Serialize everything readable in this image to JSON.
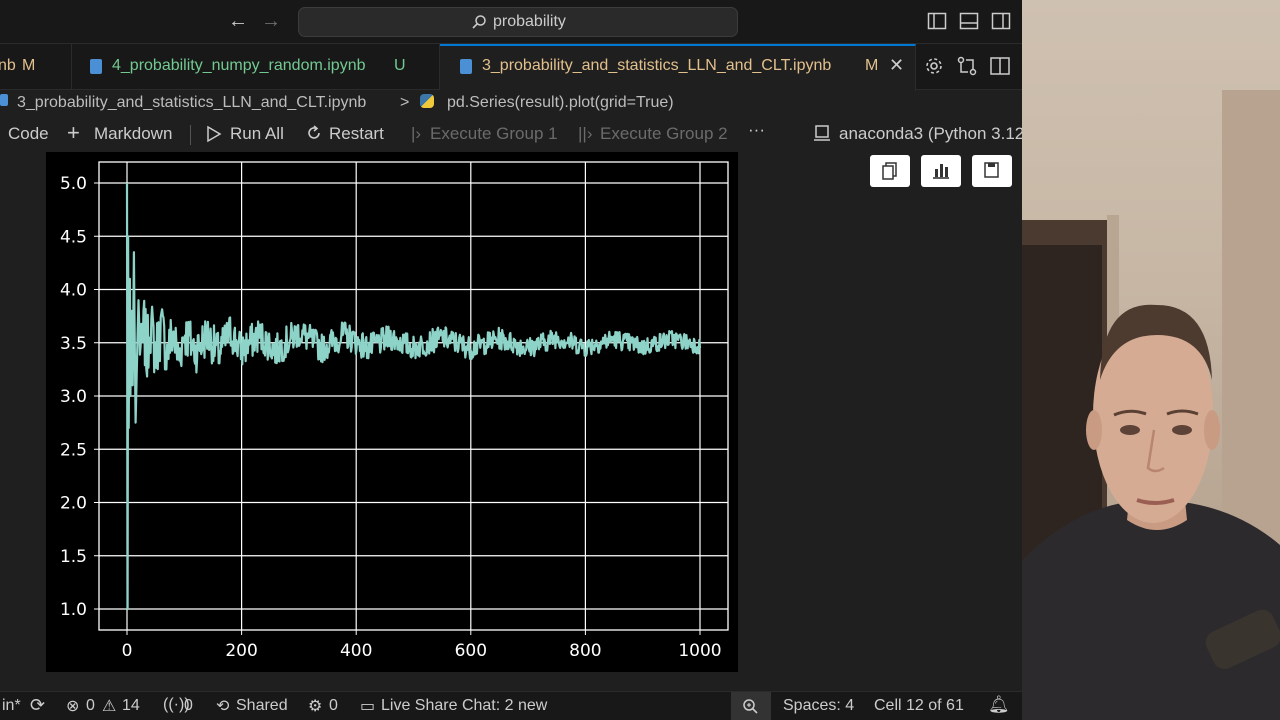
{
  "titlebar": {
    "search_text": "probability"
  },
  "tabs": [
    {
      "name": "nb",
      "status": "M",
      "name_color": "#e2c08d",
      "status_color": "#e2c08d"
    },
    {
      "name": "4_probability_numpy_random.ipynb",
      "status": "U",
      "name_color": "#73c991",
      "status_color": "#73c991"
    },
    {
      "name": "3_probability_and_statistics_LLN_and_CLT.ipynb",
      "status": "M",
      "name_color": "#e2c08d",
      "status_color": "#e2c08d",
      "active": true
    }
  ],
  "breadcrumb": {
    "file": "3_probability_and_statistics_LLN_and_CLT.ipynb",
    "separator": ">",
    "cell": "pd.Series(result).plot(grid=True)"
  },
  "toolbar": {
    "code_label": "Code",
    "markdown_label": "Markdown",
    "run_all_label": "Run All",
    "restart_label": "Restart",
    "execute_group_1_label": "Execute Group 1",
    "execute_group_2_label": "Execute Group 2",
    "more_label": "···",
    "kernel_label": "anaconda3 (Python 3.12"
  },
  "chart_data": {
    "type": "line",
    "title": "",
    "xlabel": "",
    "ylabel": "",
    "grid": true,
    "xlim": [
      0,
      1000
    ],
    "ylim": [
      0.9,
      5.2
    ],
    "x_ticks": [
      "0",
      "200",
      "400",
      "600",
      "800",
      "1000"
    ],
    "x_tick_values": [
      0,
      200,
      400,
      600,
      800,
      1000
    ],
    "y_ticks": [
      "1.0",
      "1.5",
      "2.0",
      "2.5",
      "3.0",
      "3.5",
      "4.0",
      "4.5",
      "5.0"
    ],
    "y_tick_values": [
      1.0,
      1.5,
      2.0,
      2.5,
      3.0,
      3.5,
      4.0,
      4.5,
      5.0
    ],
    "series_color": "#8dd3c7",
    "series": [
      {
        "name": "",
        "x": [
          0,
          1,
          2,
          3,
          4,
          5,
          6,
          8,
          10,
          12,
          15,
          20,
          25,
          30,
          35,
          40,
          50,
          60,
          70,
          80,
          90,
          100,
          120,
          140,
          160,
          180,
          200,
          230,
          260,
          300,
          340,
          380,
          420,
          460,
          500,
          550,
          600,
          650,
          700,
          750,
          800,
          850,
          900,
          950,
          1000
        ],
        "values": [
          5.0,
          1.0,
          4.5,
          2.7,
          3.6,
          4.1,
          3.0,
          3.8,
          3.1,
          4.35,
          2.75,
          3.9,
          3.2,
          3.75,
          3.25,
          3.9,
          3.3,
          3.8,
          3.3,
          3.7,
          3.2,
          3.7,
          3.35,
          3.65,
          3.3,
          3.7,
          3.35,
          3.65,
          3.35,
          3.7,
          3.4,
          3.65,
          3.4,
          3.6,
          3.4,
          3.6,
          3.4,
          3.58,
          3.4,
          3.6,
          3.42,
          3.58,
          3.42,
          3.58,
          3.45
        ]
      }
    ]
  },
  "output_actions": [
    {
      "icon": "copy-icon"
    },
    {
      "icon": "chart-icon"
    },
    {
      "icon": "save-icon"
    }
  ],
  "statusbar": {
    "branch": "in*",
    "errors": "0",
    "warnings": "14",
    "ports": "0",
    "shared_label": "Shared",
    "extensions_count": "0",
    "chat_label": "Live Share Chat: 2 new",
    "spaces_label": "Spaces: 4",
    "cell_label": "Cell 12 of 61"
  }
}
